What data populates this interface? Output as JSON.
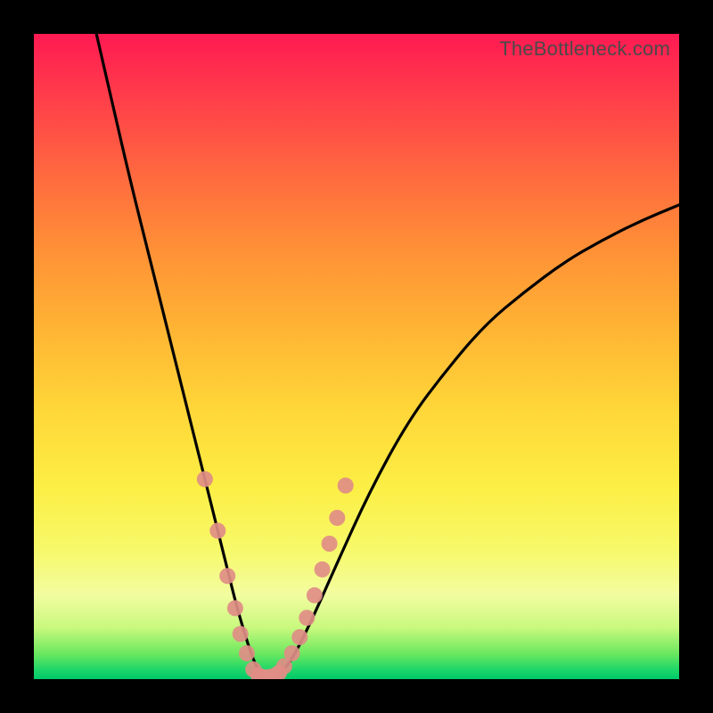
{
  "watermark": "TheBottleneck.com",
  "chart_data": {
    "type": "line",
    "title": "",
    "xlabel": "",
    "ylabel": "",
    "xlim": [
      0,
      100
    ],
    "ylim": [
      0,
      100
    ],
    "series": [
      {
        "name": "curve",
        "x": [
          9,
          12,
          15,
          18,
          21,
          24,
          26,
          28,
          30,
          31.5,
          33,
          34,
          35,
          36.5,
          38,
          40,
          43,
          47,
          52,
          58,
          64,
          70,
          76,
          82,
          88,
          94,
          100
        ],
        "y": [
          103,
          90,
          77,
          65,
          53,
          41,
          33,
          25,
          17,
          11,
          6,
          3,
          1,
          0.3,
          0.7,
          3,
          9,
          18,
          29,
          40,
          48,
          55,
          60,
          64.5,
          68,
          71,
          73.5
        ]
      }
    ],
    "scatter": {
      "name": "points",
      "x": [
        26.5,
        28.5,
        30,
        31.2,
        32,
        33,
        34,
        34.8,
        35.5,
        36.3,
        37.2,
        38,
        38.8,
        40,
        41.2,
        42.3,
        43.5,
        44.7,
        45.8,
        47,
        48.3
      ],
      "y": [
        31,
        23,
        16,
        11,
        7,
        4,
        1.5,
        0.6,
        0.3,
        0.3,
        0.5,
        1,
        2,
        4,
        6.5,
        9.5,
        13,
        17,
        21,
        25,
        30
      ]
    },
    "colors": {
      "curve": "#000000",
      "points": "#e08d86"
    }
  }
}
